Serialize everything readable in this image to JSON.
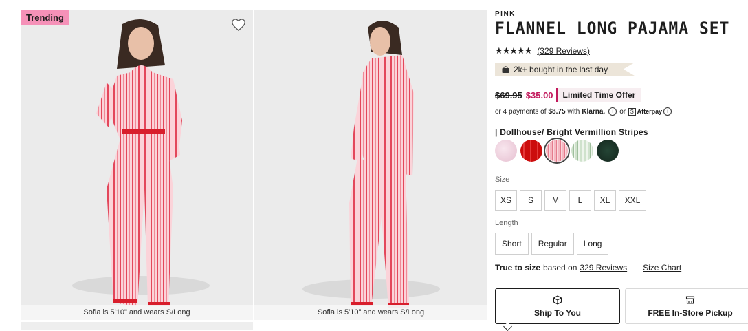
{
  "gallery": {
    "badge": "Trending",
    "captions": [
      "Sofia is 5'10\" and wears S/Long",
      "Sofia is 5'10\" and wears S/Long"
    ]
  },
  "product": {
    "brand": "PINK",
    "title": "FLANNEL LONG PAJAMA SET",
    "stars": "★★★★★",
    "reviews_link": "(329 Reviews)",
    "bought_badge": "2k+ bought in the last day",
    "old_price": "$69.95",
    "new_price": "$35.00",
    "offer": "Limited Time Offer",
    "payments": {
      "prefix": "or 4 payments of",
      "amount": "$8.75",
      "with": "with",
      "klarna": "Klarna.",
      "or": "or",
      "afterpay_mark": "$",
      "afterpay": "Afterpay"
    },
    "color_label": "| Dollhouse/ Bright Vermillion Stripes",
    "swatches": [
      "Pink Solid",
      "Red Plaid",
      "Dollhouse/ Bright Vermillion Stripes",
      "Green Stripes",
      "Green Tartan"
    ],
    "size_label": "Size",
    "sizes": [
      "XS",
      "S",
      "M",
      "L",
      "XL",
      "XXL"
    ],
    "length_label": "Length",
    "lengths": [
      "Short",
      "Regular",
      "Long"
    ],
    "fit": {
      "bold": "True to size",
      "based_on": "based on",
      "reviews": "329 Reviews",
      "size_chart": "Size Chart"
    },
    "shipping": {
      "ship_to_you": "Ship To You",
      "pickup": "FREE In-Store Pickup"
    }
  },
  "colors": {
    "accent": "#c2185b",
    "badge": "#f591b8"
  }
}
